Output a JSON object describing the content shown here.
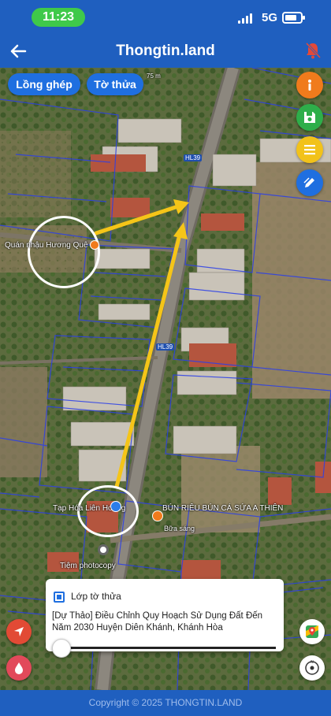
{
  "status_bar": {
    "time": "11:23",
    "network": "5G"
  },
  "header": {
    "title": "Thongtin.land",
    "back_icon": "arrow-left-icon",
    "notify_icon": "bell-off-icon"
  },
  "map": {
    "toggles": [
      "Lồng ghép",
      "Tờ thửa"
    ],
    "scale_label": "75 m",
    "road_labels": [
      "HL39",
      "HL39"
    ],
    "places": [
      {
        "name": "Quán nhậu Hương Quê",
        "icon": "restaurant-pin-icon"
      },
      {
        "name": "BÚN RIÊU BÚN CÁ SỨA A THIÊN",
        "icon": "restaurant-pin-icon"
      },
      {
        "name": "Bữa sáng"
      },
      {
        "name": "Tạp Hóa Liên Hoàng",
        "icon": "shop-pin-icon"
      },
      {
        "name": "Tiệm photocopy",
        "icon": "shop-pin-icon"
      }
    ],
    "right_tools": [
      {
        "name": "info-icon",
        "color": "#f07b1c"
      },
      {
        "name": "save-icon",
        "color": "#2eae4a"
      },
      {
        "name": "list-icon",
        "color": "#f2c21a"
      },
      {
        "name": "edit-plot-icon",
        "color": "#1f6fe0"
      }
    ],
    "arrow_color": "#f5c518"
  },
  "layer_card": {
    "checkbox_label": "Lớp tờ thửa",
    "checked": true,
    "description": "[Dự Thảo] Điều Chỉnh Quy Hoạch Sử Dụng Đất Đến Năm 2030 Huyện Diên Khánh, Khánh Hòa",
    "opacity": 0.0
  },
  "footer": {
    "copyright": "Copyright © 2025 THONGTIN.LAND"
  }
}
